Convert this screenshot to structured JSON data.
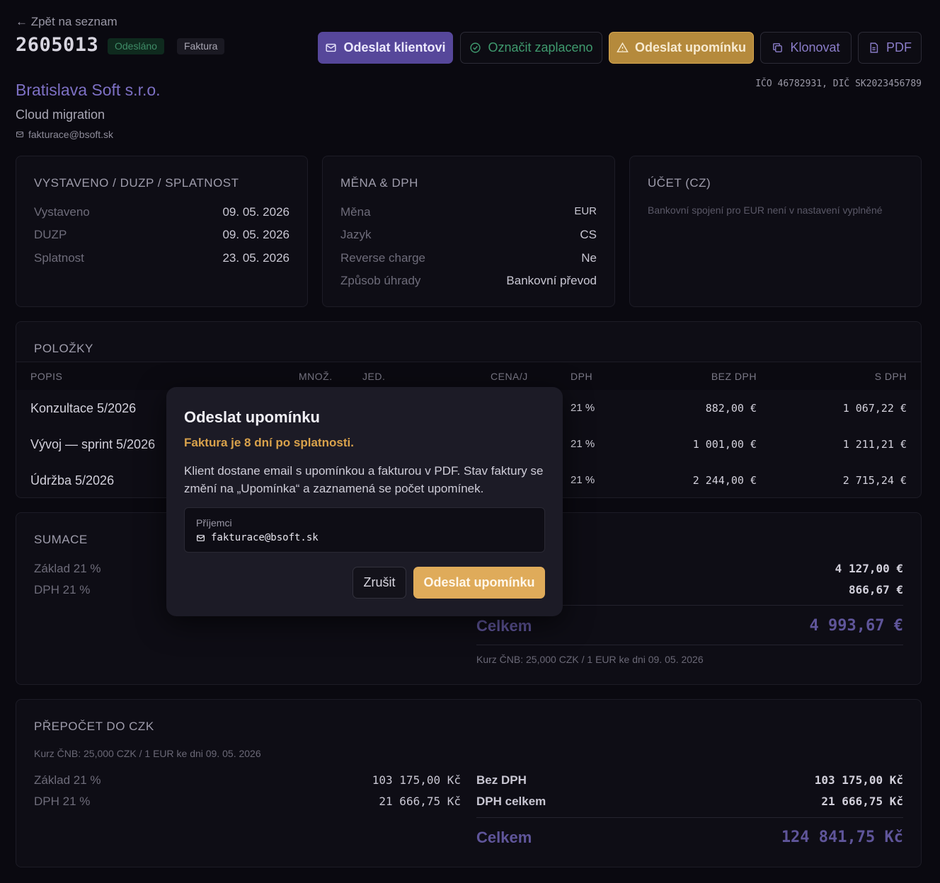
{
  "header": {
    "back_label": "← Zpět na seznam",
    "invoice_number": "2605013",
    "status_badge": "Odesláno",
    "type_badge": "Faktura"
  },
  "actions": {
    "send_client": "Odeslat klientovi",
    "mark_paid": "Označit zaplaceno",
    "send_reminder": "Odeslat upomínku",
    "clone": "Klonovat",
    "pdf": "PDF"
  },
  "client": {
    "name": "Bratislava Soft s.r.o.",
    "project": "Cloud migration",
    "email": "fakturace@bsoft.sk",
    "ids": "IČO 46782931, DIČ SK2023456789"
  },
  "dates_panel": {
    "title": "VYSTAVENO / DUZP / SPLATNOST",
    "rows": [
      {
        "label": "Vystaveno",
        "value": "09. 05. 2026"
      },
      {
        "label": "DUZP",
        "value": "09. 05. 2026"
      },
      {
        "label": "Splatnost",
        "value": "23. 05. 2026"
      }
    ]
  },
  "currency_panel": {
    "title": "MĚNA & DPH",
    "rows": [
      {
        "label": "Měna",
        "value": "EUR"
      },
      {
        "label": "Jazyk",
        "value": "CS"
      },
      {
        "label": "Reverse charge",
        "value": "Ne"
      },
      {
        "label": "Způsob úhrady",
        "value": "Bankovní převod"
      }
    ]
  },
  "account_panel": {
    "title": "ÚČET (CZ)",
    "note": "Bankovní spojení pro EUR není v nastavení vyplněné"
  },
  "items": {
    "title": "POLOŽKY",
    "columns": {
      "desc": "POPIS",
      "qty": "MNOŽ.",
      "unit": "JED.",
      "price": "CENA/J",
      "vat": "DPH",
      "net": "BEZ DPH",
      "gross": "S DPH"
    },
    "rows": [
      {
        "desc": "Konzultace 5/2026",
        "vat": "21 %",
        "net": "882,00 €",
        "gross": "1 067,22 €"
      },
      {
        "desc": "Vývoj — sprint 5/2026",
        "vat": "21 %",
        "net": "1 001,00 €",
        "gross": "1 211,21 €"
      },
      {
        "desc": "Údržba 5/2026",
        "vat": "21 %",
        "net": "2 244,00 €",
        "gross": "2 715,24 €"
      }
    ]
  },
  "summary": {
    "title": "SUMACE",
    "left": [
      {
        "label": "Základ 21 %"
      },
      {
        "label": "DPH 21 %"
      }
    ],
    "right_amounts": [
      "4 127,00 €",
      "866,67 €"
    ],
    "total_label": "Celkem",
    "total_value": "4 993,67 €",
    "rate_note": "Kurz ČNB: 25,000 CZK / 1 EUR ke dni 09. 05. 2026"
  },
  "czk": {
    "title": "PŘEPOČET DO CZK",
    "note": "Kurz ČNB: 25,000 CZK / 1 EUR ke dni 09. 05. 2026",
    "left": [
      {
        "label": "Základ 21 %",
        "value": "103 175,00 Kč"
      },
      {
        "label": "DPH 21 %",
        "value": "21 666,75 Kč"
      }
    ],
    "right": [
      {
        "label": "Bez DPH",
        "value": "103 175,00 Kč"
      },
      {
        "label": "DPH celkem",
        "value": "21 666,75 Kč"
      }
    ],
    "total_label": "Celkem",
    "total_value": "124 841,75 Kč"
  },
  "modal": {
    "title": "Odeslat upomínku",
    "warning": "Faktura je 8 dní po splatnosti.",
    "body": "Klient dostane email s upomínkou a fakturou v PDF. Stav faktury se změní na „Upomínka“ a zaznamená se počet upomínek.",
    "recipients_label": "Příjemci",
    "recipient_email": "fakturace@bsoft.sk",
    "cancel": "Zrušit",
    "confirm": "Odeslat upomínku"
  },
  "colors": {
    "background": "#0a0910",
    "accent": "#56479a",
    "warning": "#d9a24b",
    "success": "#3f9a6e"
  }
}
